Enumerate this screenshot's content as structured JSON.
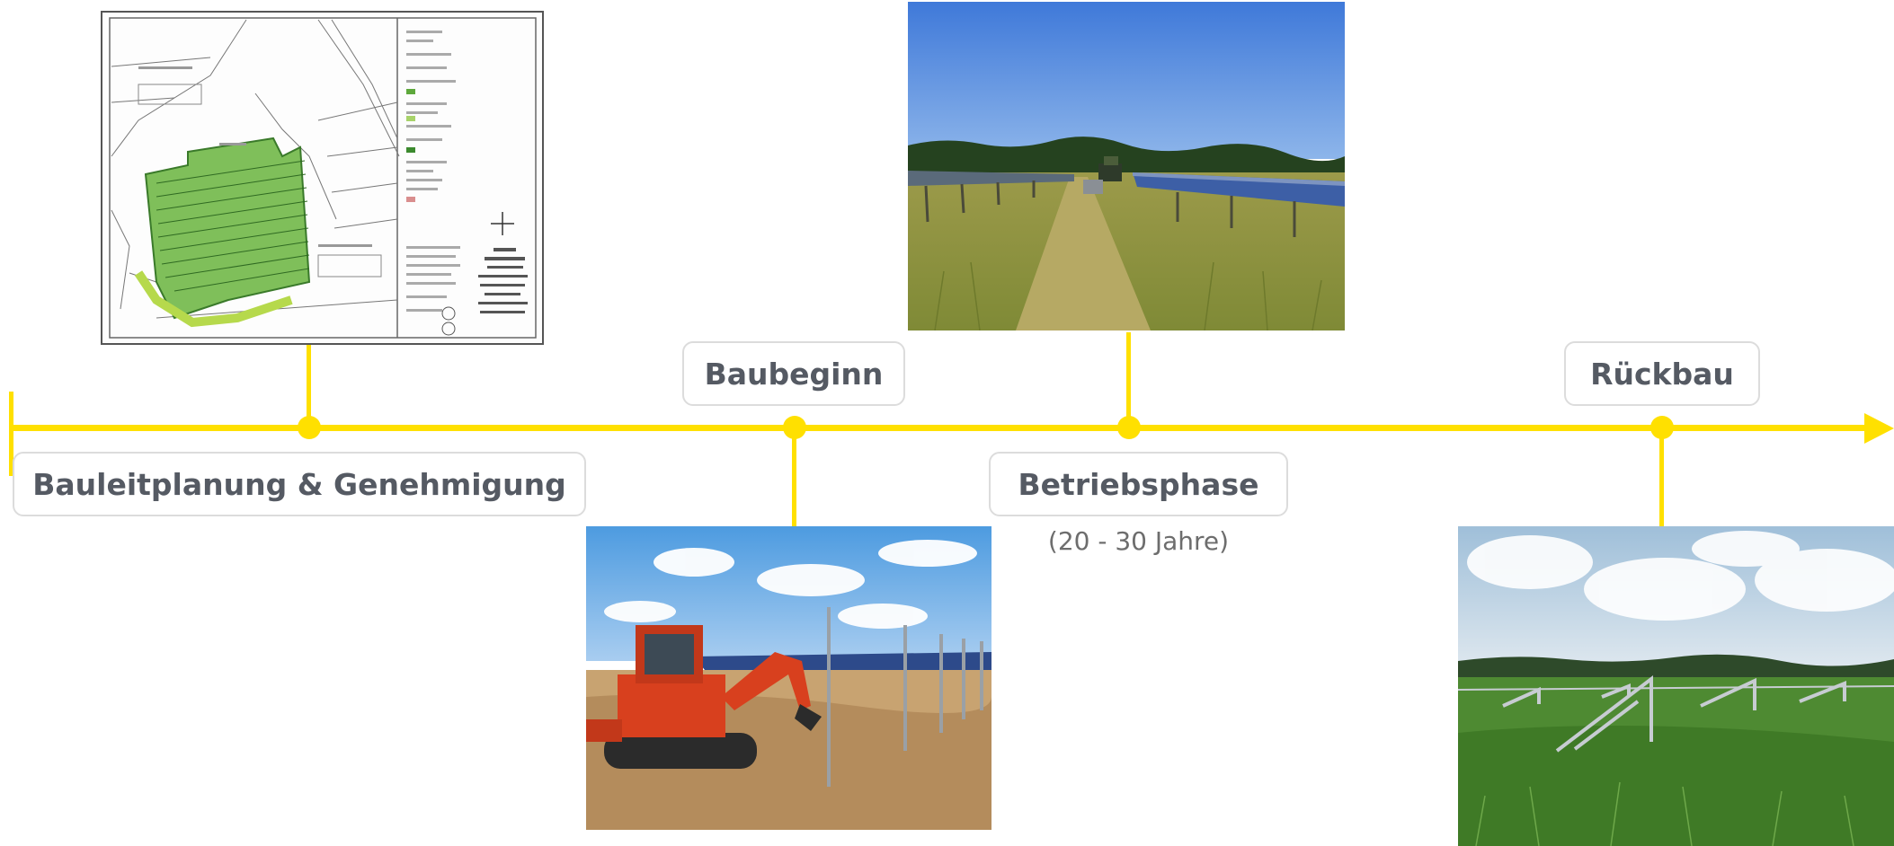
{
  "colors": {
    "timeline": "#FFE000",
    "label_text": "#555a63",
    "label_border": "#dcdcdc",
    "subtitle_text": "#6d6d6d"
  },
  "phases": [
    {
      "label": "Bauleitplanung & Genehmigung",
      "image": "site-plan-map"
    },
    {
      "label": "Baubeginn",
      "image": "excavator-construction-photo"
    },
    {
      "label": "Betriebsphase",
      "sublabel": "(20 - 30 Jahre)",
      "image": "mowing-between-panels-photo"
    },
    {
      "label": "Rückbau",
      "image": "dismantled-racks-photo"
    }
  ]
}
